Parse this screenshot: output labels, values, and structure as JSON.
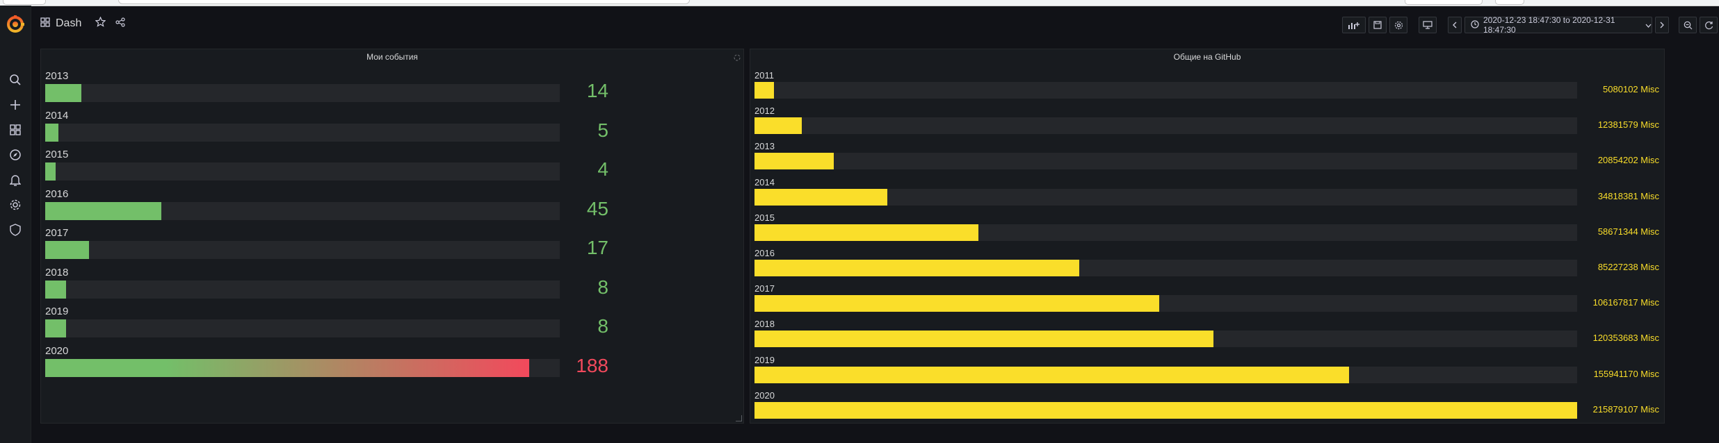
{
  "dashboard": {
    "title": "Dash"
  },
  "time_range": {
    "label": "2020-12-23 18:47:30 to 2020-12-31 18:47:30"
  },
  "colors": {
    "green": "#73bf69",
    "red": "#f2495c",
    "yellow": "#fade2a",
    "track": "#25272b"
  },
  "sidemenu": {
    "icons": [
      "grafana-logo-icon",
      "search-icon",
      "plus-icon",
      "dashboards-icon",
      "explore-icon",
      "alerting-icon",
      "settings-icon",
      "shield-icon"
    ]
  },
  "panels": {
    "left": {
      "title": "Мои события",
      "max": 200,
      "rows": [
        {
          "label": "2013",
          "value": 14,
          "text": "14"
        },
        {
          "label": "2014",
          "value": 5,
          "text": "5"
        },
        {
          "label": "2015",
          "value": 4,
          "text": "4"
        },
        {
          "label": "2016",
          "value": 45,
          "text": "45"
        },
        {
          "label": "2017",
          "value": 17,
          "text": "17"
        },
        {
          "label": "2018",
          "value": 8,
          "text": "8"
        },
        {
          "label": "2019",
          "value": 8,
          "text": "8"
        },
        {
          "label": "2020",
          "value": 188,
          "text": "188"
        }
      ]
    },
    "right": {
      "title": "Общие на GitHub",
      "max": 215879107,
      "unit": "Misc",
      "rows": [
        {
          "label": "2011",
          "value": 5080102,
          "text": "5080102 Misc"
        },
        {
          "label": "2012",
          "value": 12381579,
          "text": "12381579 Misc"
        },
        {
          "label": "2013",
          "value": 20854202,
          "text": "20854202 Misc"
        },
        {
          "label": "2014",
          "value": 34818381,
          "text": "34818381 Misc"
        },
        {
          "label": "2015",
          "value": 58671344,
          "text": "58671344 Misc"
        },
        {
          "label": "2016",
          "value": 85227238,
          "text": "85227238 Misc"
        },
        {
          "label": "2017",
          "value": 106167817,
          "text": "106167817 Misc"
        },
        {
          "label": "2018",
          "value": 120353683,
          "text": "120353683 Misc"
        },
        {
          "label": "2019",
          "value": 155941170,
          "text": "155941170 Misc"
        },
        {
          "label": "2020",
          "value": 215879107,
          "text": "215879107 Misc"
        }
      ]
    }
  }
}
